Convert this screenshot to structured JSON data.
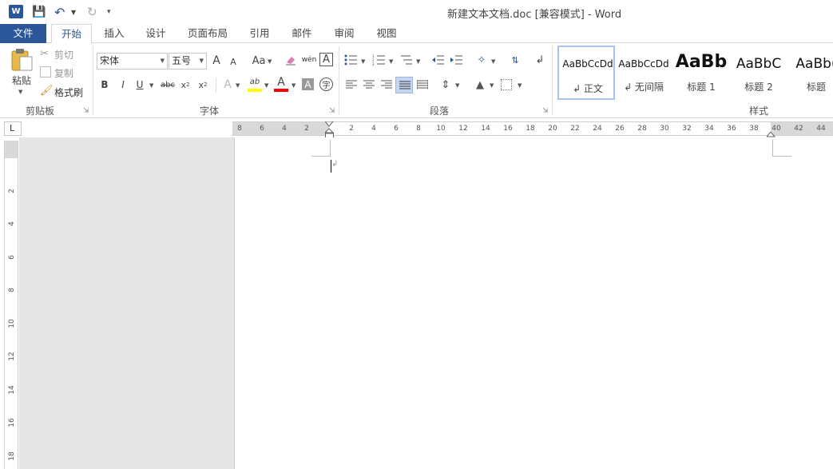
{
  "window": {
    "title": "新建文本文档.doc [兼容模式] - Word"
  },
  "qat": {
    "logo": "W"
  },
  "tabs": [
    "文件",
    "开始",
    "插入",
    "设计",
    "页面布局",
    "引用",
    "邮件",
    "审阅",
    "视图"
  ],
  "clipboard": {
    "paste": "粘贴",
    "cut": "剪切",
    "copy": "复制",
    "format_painter": "格式刷",
    "group": "剪贴板"
  },
  "font": {
    "name": "宋体",
    "size": "五号",
    "group": "字体",
    "grow": "A",
    "shrink": "A",
    "case": "Aa",
    "phonetic": "wén",
    "border_char": "A",
    "bold": "B",
    "italic": "I",
    "underline": "U",
    "strike": "abc",
    "subscript": "x",
    "superscript": "x",
    "effects": "A",
    "highlight": "ab",
    "color": "A",
    "shade": "A",
    "enclose": "字"
  },
  "paragraph": {
    "group": "段落"
  },
  "styles": {
    "group": "样式",
    "items": [
      {
        "sample": "AaBbCcDd",
        "name": "↲ 正文"
      },
      {
        "sample": "AaBbCcDd",
        "name": "↲ 无间隔"
      },
      {
        "sample": "AaBb",
        "name": "标题 1"
      },
      {
        "sample": "AaBbC",
        "name": "标题 2"
      },
      {
        "sample": "AaBb(",
        "name": "标题"
      }
    ]
  },
  "ruler": {
    "corner": "L",
    "left_numbers": [
      "8",
      "6",
      "4",
      "2"
    ],
    "right_numbers": [
      "2",
      "4",
      "6",
      "8",
      "10",
      "12",
      "14",
      "16",
      "18",
      "20",
      "22",
      "24",
      "26",
      "28",
      "30",
      "32",
      "34",
      "36",
      "38",
      "40",
      "42",
      "44"
    ],
    "vertical_numbers": [
      "2",
      "4",
      "6",
      "8",
      "10",
      "12",
      "14",
      "16",
      "18"
    ]
  },
  "colors": {
    "accent": "#2b579a",
    "highlight_yellow": "#ffff00",
    "font_red": "#ff0000"
  }
}
